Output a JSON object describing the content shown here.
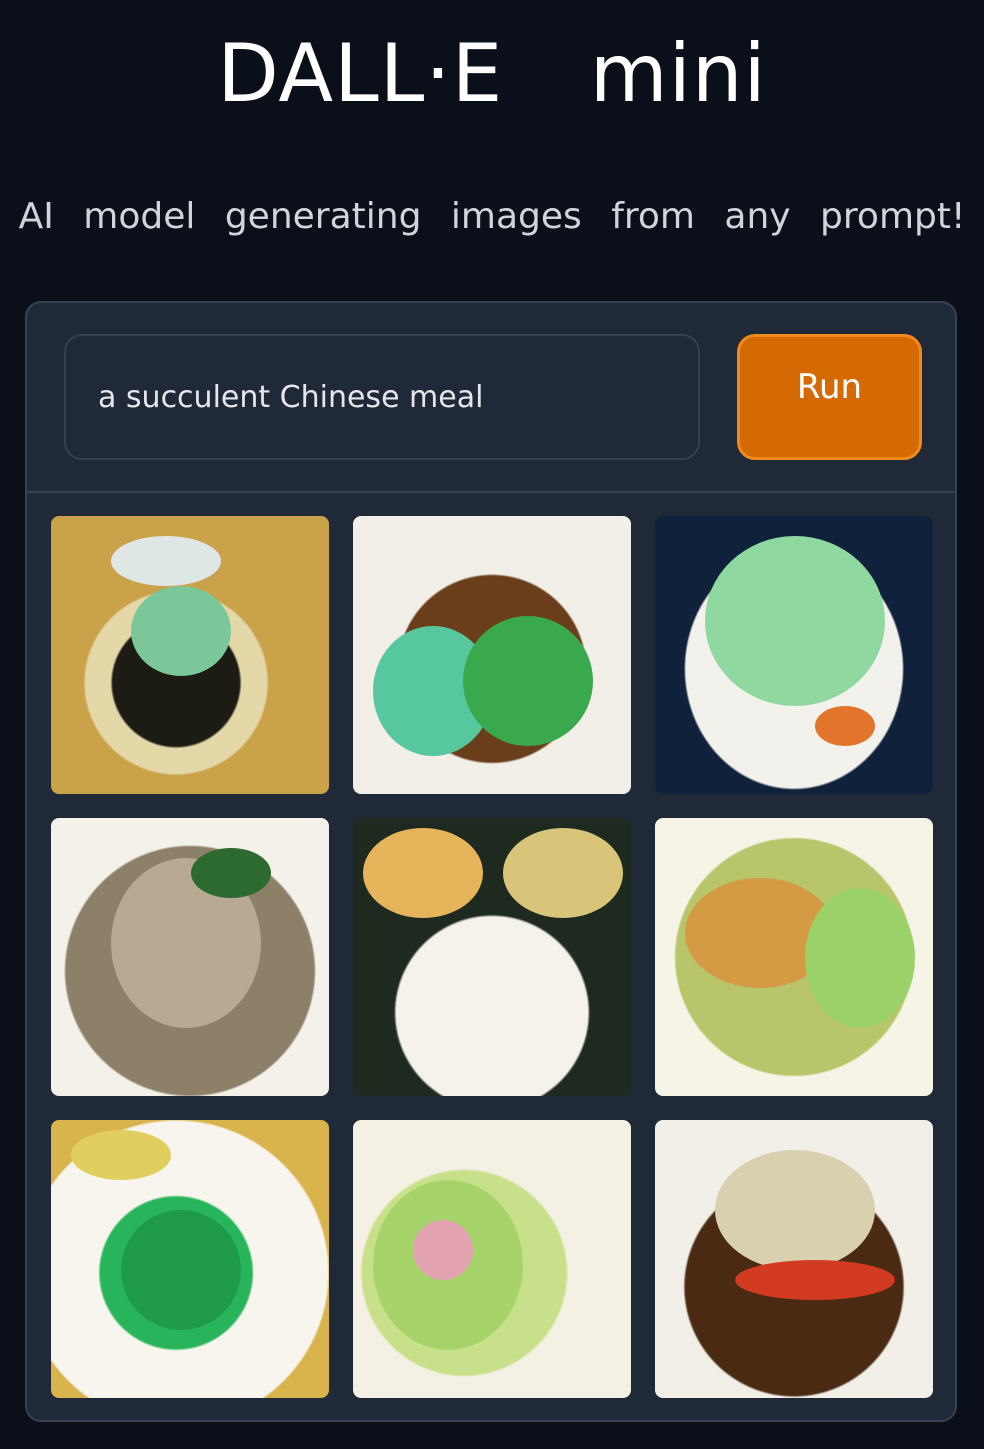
{
  "header": {
    "title": "DALL·E mini",
    "subtitle": "AI model generating images from any prompt!"
  },
  "form": {
    "prompt_value": "a succulent Chinese meal",
    "run_label": "Run"
  },
  "colors": {
    "background": "#0b0f19",
    "panel": "#1f2937",
    "border": "#374151",
    "run_button": "#d56a05"
  },
  "results": {
    "count": 9,
    "images": [
      "generated-image",
      "generated-image",
      "generated-image",
      "generated-image",
      "generated-image",
      "generated-image",
      "generated-image",
      "generated-image",
      "generated-image"
    ]
  }
}
